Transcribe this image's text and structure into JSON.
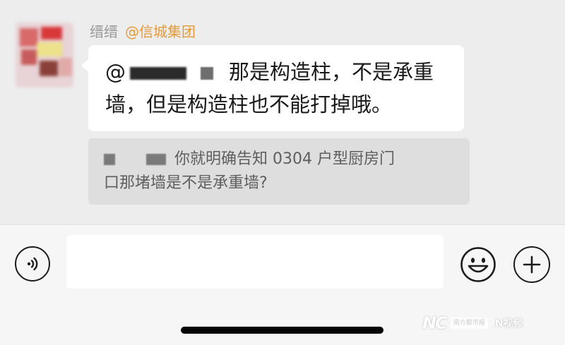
{
  "chat": {
    "sender_nickname": "缙缙",
    "sender_mention": "@信城集团",
    "message": {
      "line1_prefix": "@",
      "line1_text": "那是构造柱，不是承重",
      "line2_text": "墙，但是构造柱也不能打掉哦。"
    },
    "quote": {
      "line1_text": "你就明确告知 0304 户型厨房门",
      "line2_text": "口那堵墙是不是承重墙?"
    }
  },
  "input_bar": {
    "input_value": "",
    "voice_icon": "voice-icon",
    "emoji_icon": "emoji-icon",
    "plus_icon": "plus-icon"
  },
  "watermark": {
    "logo": "NC",
    "small_box": "南方都市报",
    "n_label": "N视频"
  },
  "colors": {
    "chat_bg": "#ededed",
    "bubble_bg": "#ffffff",
    "quote_bg": "#dedede",
    "mention": "#e39a3a",
    "nickname": "#9a9a9a",
    "input_bar_bg": "#f6f6f6"
  }
}
